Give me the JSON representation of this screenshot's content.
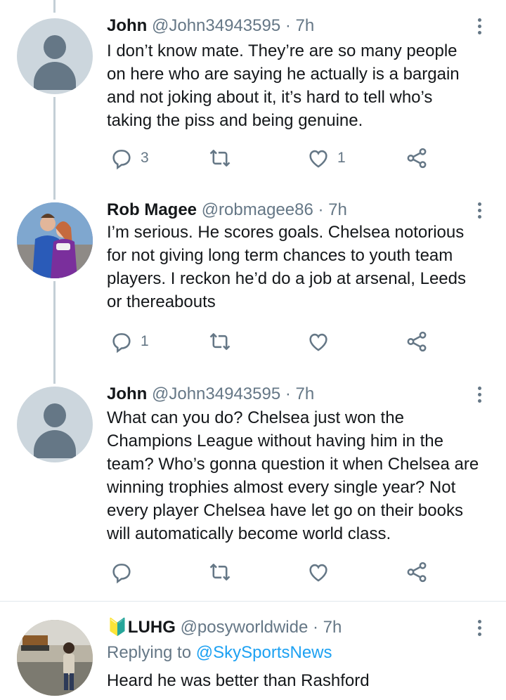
{
  "tweets": [
    {
      "name": "John",
      "handle": "@John34943595 · 7h",
      "lines": [
        "I don’t know mate. They’re are so many people",
        "on here who are saying he actually is a bargain",
        "and not joking about it, it’s hard to tell who’s",
        "taking the piss and being genuine."
      ],
      "reply_count": "3",
      "retweet_count": "",
      "like_count": "1"
    },
    {
      "name": "Rob Magee",
      "handle": "@robmagee86 · 7h",
      "lines": [
        "I’m serious. He scores goals. Chelsea notorious",
        "for not giving long term chances to youth team",
        "players. I reckon he’d do a job at arsenal, Leeds",
        "or thereabouts"
      ],
      "reply_count": "1",
      "retweet_count": "",
      "like_count": ""
    },
    {
      "name": "John",
      "handle": "@John34943595 · 7h",
      "lines": [
        "What can you do? Chelsea just won the",
        "Champions League without having him in the",
        "team? Who’s gonna question it when Chelsea are",
        "winning trophies almost every single year? Not",
        "every player Chelsea have let go on their books",
        "will automatically become world class."
      ],
      "reply_count": "",
      "retweet_count": "",
      "like_count": ""
    },
    {
      "name": "LUHG",
      "name_emoji": "🔰",
      "handle": "@posyworldwide · 7h",
      "replying_prefix": "Replying to",
      "replying_to": "@SkySportsNews",
      "lines": [
        "Heard he was better than Rashford"
      ]
    }
  ],
  "colors": {
    "text": "#14171a",
    "secondary": "#657786",
    "link": "#1da1f2",
    "thread_line": "#c4cfd6"
  },
  "icons": [
    "reply-icon",
    "retweet-icon",
    "like-icon",
    "share-icon",
    "more-icon",
    "default-avatar-icon"
  ]
}
